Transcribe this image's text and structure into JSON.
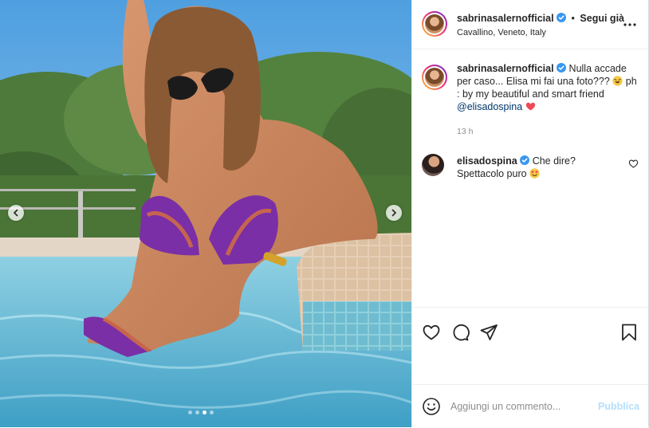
{
  "post": {
    "username": "sabrinasalernofficial",
    "follow_label": "Segui già",
    "separator": "•",
    "location": "Cavallino, Veneto, Italy",
    "caption_lead": "Nulla accade per caso... Elisa mi fai una foto???",
    "caption_tail": "ph : by my beautiful and smart friend",
    "caption_mention": "@elisadospina",
    "time": "13 h"
  },
  "comment": {
    "username": "elisadospina",
    "text": "Che dire? Spettacolo puro"
  },
  "composer": {
    "placeholder": "Aggiungi un commento...",
    "post_label": "Pubblica"
  },
  "carousel": {
    "slide_count": 4,
    "active_index": 2
  },
  "icons": {
    "verified": "verified-badge-icon",
    "more": "more-options-icon",
    "like": "heart-icon",
    "comment": "comment-bubble-icon",
    "share": "paper-plane-icon",
    "save": "bookmark-icon",
    "emoji": "smiley-icon"
  },
  "colors": {
    "accent": "#0095f6",
    "verified": "#3897f0",
    "mention": "#00376b",
    "muted": "#8e8e8e",
    "post_disabled": "#b2dffc",
    "heart_emoji": "#ed4956"
  }
}
